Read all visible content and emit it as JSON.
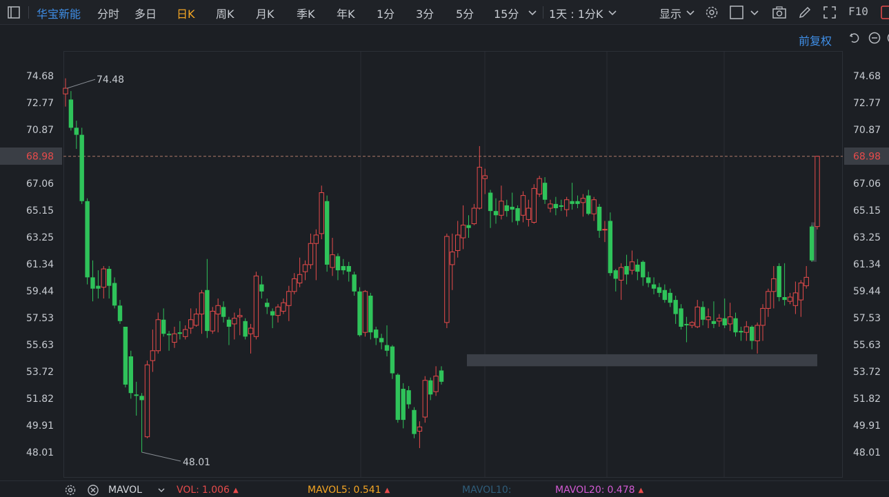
{
  "toolbar": {
    "stock_name": "华宝新能",
    "periods": [
      "分时",
      "多日",
      "日K",
      "周K",
      "月K",
      "季K",
      "年K",
      "1分",
      "3分",
      "5分",
      "15分"
    ],
    "active_period": "日K",
    "interval_select": "1天 : 1分K",
    "display_label": "显示",
    "f10_label": "F10"
  },
  "subbar": {
    "adjust_label": "前复权"
  },
  "colors": {
    "up": "#e84b4b",
    "down": "#2fc35a",
    "accent": "#3f8fe8",
    "active": "#f5a623",
    "background": "#1c1f24"
  },
  "chart_data": {
    "type": "candlestick",
    "y_axis_ticks": [
      "74.68",
      "72.77",
      "70.87",
      "68.98",
      "67.06",
      "65.15",
      "63.25",
      "61.34",
      "59.44",
      "57.53",
      "55.63",
      "53.72",
      "51.82",
      "49.91",
      "48.01"
    ],
    "ylim": [
      47.0,
      75.5
    ],
    "current_price": "68.98",
    "high_label": "74.48",
    "low_label": "48.01",
    "candles": [
      [
        73.4,
        73.8,
        72.5,
        74.5
      ],
      [
        73.0,
        71.0,
        70.8,
        73.6
      ],
      [
        71.0,
        70.5,
        69.5,
        71.5
      ],
      [
        70.5,
        65.8,
        65.6,
        71.0
      ],
      [
        65.8,
        60.4,
        59.9,
        66.0
      ],
      [
        60.4,
        59.6,
        58.7,
        61.6
      ],
      [
        59.8,
        59.6,
        58.9,
        60.9
      ],
      [
        59.7,
        61.0,
        58.9,
        61.2
      ],
      [
        61.0,
        59.8,
        58.9,
        61.2
      ],
      [
        60.0,
        58.4,
        58.2,
        60.4
      ],
      [
        58.4,
        57.3,
        57.1,
        58.8
      ],
      [
        56.9,
        52.8,
        52.6,
        56.9
      ],
      [
        54.8,
        52.2,
        51.8,
        55.2
      ],
      [
        52.1,
        52.0,
        50.6,
        53.0
      ],
      [
        52.0,
        51.7,
        48.0,
        52.2
      ],
      [
        49.1,
        54.2,
        49.0,
        54.5
      ],
      [
        54.5,
        55.2,
        53.7,
        56.7
      ],
      [
        55.2,
        57.4,
        55.0,
        57.9
      ],
      [
        57.4,
        56.4,
        56.2,
        58.2
      ],
      [
        56.4,
        56.3,
        55.2,
        56.6
      ],
      [
        55.8,
        56.4,
        55.4,
        56.9
      ],
      [
        56.5,
        56.4,
        56.0,
        57.3
      ],
      [
        56.2,
        56.7,
        56.0,
        57.0
      ],
      [
        56.8,
        57.4,
        56.4,
        58.2
      ],
      [
        57.0,
        57.8,
        56.9,
        58.2
      ],
      [
        57.8,
        59.3,
        56.4,
        59.5
      ],
      [
        59.5,
        56.6,
        56.1,
        61.7
      ],
      [
        56.6,
        58.0,
        56.4,
        58.3
      ],
      [
        57.8,
        58.4,
        56.5,
        58.9
      ],
      [
        58.3,
        57.6,
        57.2,
        58.7
      ],
      [
        57.4,
        56.9,
        55.6,
        57.6
      ],
      [
        57.1,
        57.5,
        56.0,
        57.9
      ],
      [
        57.6,
        57.7,
        56.3,
        58.2
      ],
      [
        57.3,
        56.2,
        56.0,
        57.5
      ],
      [
        56.4,
        56.8,
        55.0,
        57.1
      ],
      [
        56.2,
        60.5,
        56.0,
        60.8
      ],
      [
        59.9,
        59.4,
        58.9,
        60.5
      ],
      [
        58.6,
        58.3,
        57.8,
        58.9
      ],
      [
        58.0,
        57.7,
        56.8,
        58.2
      ],
      [
        57.7,
        58.3,
        57.2,
        58.5
      ],
      [
        58.0,
        58.6,
        57.8,
        58.9
      ],
      [
        58.4,
        59.4,
        57.3,
        59.8
      ],
      [
        59.4,
        60.3,
        59.2,
        60.7
      ],
      [
        60.0,
        60.6,
        59.7,
        61.8
      ],
      [
        60.8,
        61.3,
        60.2,
        61.6
      ],
      [
        61.3,
        62.8,
        61.0,
        63.5
      ],
      [
        62.8,
        63.4,
        60.2,
        63.8
      ],
      [
        63.5,
        66.4,
        63.1,
        66.9
      ],
      [
        65.8,
        61.3,
        60.8,
        66.2
      ],
      [
        61.1,
        62.0,
        60.5,
        63.2
      ],
      [
        61.9,
        60.9,
        60.2,
        62.1
      ],
      [
        61.2,
        60.9,
        60.6,
        61.7
      ],
      [
        61.2,
        60.8,
        60.1,
        61.5
      ],
      [
        60.6,
        59.4,
        59.1,
        60.8
      ],
      [
        59.4,
        56.3,
        56.2,
        59.7
      ],
      [
        56.5,
        59.4,
        56.2,
        59.5
      ],
      [
        59.1,
        56.5,
        56.0,
        59.3
      ],
      [
        56.7,
        56.1,
        55.6,
        56.9
      ],
      [
        56.1,
        55.8,
        55.3,
        56.4
      ],
      [
        55.6,
        55.2,
        54.8,
        57.0
      ],
      [
        55.5,
        53.6,
        53.2,
        55.6
      ],
      [
        53.5,
        50.3,
        50.1,
        53.6
      ],
      [
        52.5,
        50.3,
        49.7,
        52.9
      ],
      [
        52.4,
        51.4,
        51.1,
        52.7
      ],
      [
        51.0,
        49.3,
        49.0,
        51.2
      ],
      [
        49.5,
        49.8,
        48.3,
        50.2
      ],
      [
        50.5,
        53.1,
        50.1,
        53.4
      ],
      [
        53.1,
        52.1,
        51.7,
        53.3
      ],
      [
        52.3,
        53.4,
        52.0,
        54.1
      ],
      [
        53.8,
        53.0,
        52.8,
        54.1
      ],
      [
        57.2,
        63.3,
        56.8,
        63.5
      ],
      [
        61.3,
        62.2,
        59.5,
        63.5
      ],
      [
        62.3,
        63.4,
        61.8,
        64.4
      ],
      [
        63.2,
        64.1,
        62.4,
        65.5
      ],
      [
        64.1,
        63.9,
        63.2,
        64.8
      ],
      [
        64.2,
        65.3,
        64.1,
        65.6
      ],
      [
        65.3,
        68.2,
        65.2,
        69.7
      ],
      [
        67.4,
        67.6,
        66.3,
        68.1
      ],
      [
        66.4,
        65.1,
        63.9,
        66.6
      ],
      [
        65.1,
        64.8,
        64.2,
        66.0
      ],
      [
        64.8,
        65.8,
        64.5,
        66.9
      ],
      [
        65.5,
        65.1,
        64.7,
        65.9
      ],
      [
        65.4,
        65.2,
        64.3,
        66.4
      ],
      [
        65.3,
        64.4,
        64.1,
        65.5
      ],
      [
        64.8,
        66.2,
        64.3,
        66.5
      ],
      [
        64.5,
        65.3,
        64.0,
        65.9
      ],
      [
        64.3,
        66.7,
        64.2,
        67.0
      ],
      [
        66.3,
        67.4,
        66.1,
        67.6
      ],
      [
        67.1,
        65.9,
        65.6,
        67.5
      ],
      [
        65.3,
        65.6,
        65.0,
        65.9
      ],
      [
        65.6,
        65.3,
        64.8,
        66.1
      ],
      [
        65.5,
        65.4,
        65.1,
        65.9
      ],
      [
        65.2,
        65.9,
        64.7,
        66.1
      ],
      [
        65.8,
        65.6,
        65.2,
        67.1
      ],
      [
        65.8,
        65.6,
        65.3,
        66.2
      ],
      [
        65.7,
        66.0,
        64.7,
        66.3
      ],
      [
        66.2,
        64.9,
        64.8,
        66.6
      ],
      [
        64.9,
        65.9,
        64.4,
        66.1
      ],
      [
        65.4,
        63.7,
        63.2,
        65.6
      ],
      [
        63.8,
        63.8,
        62.9,
        64.4
      ],
      [
        64.4,
        60.7,
        60.5,
        65.0
      ],
      [
        60.9,
        60.3,
        59.4,
        61.0
      ],
      [
        60.2,
        61.1,
        58.8,
        61.4
      ],
      [
        61.2,
        60.6,
        59.9,
        62.0
      ],
      [
        60.9,
        61.5,
        60.6,
        62.3
      ],
      [
        61.3,
        60.8,
        60.2,
        61.7
      ],
      [
        61.5,
        60.4,
        59.8,
        61.6
      ],
      [
        60.4,
        60.0,
        59.7,
        60.8
      ],
      [
        59.9,
        59.6,
        59.2,
        60.4
      ],
      [
        59.7,
        59.3,
        59.0,
        60.0
      ],
      [
        59.5,
        58.8,
        58.6,
        59.9
      ],
      [
        59.3,
        58.6,
        58.3,
        59.6
      ],
      [
        58.8,
        57.8,
        57.1,
        59.1
      ],
      [
        58.2,
        56.9,
        56.7,
        58.5
      ],
      [
        57.1,
        57.0,
        55.8,
        57.6
      ],
      [
        57.0,
        57.2,
        56.8,
        57.3
      ],
      [
        56.9,
        58.3,
        56.8,
        58.8
      ],
      [
        58.3,
        57.4,
        57.0,
        58.7
      ],
      [
        57.4,
        57.6,
        56.8,
        58.2
      ],
      [
        57.3,
        57.1,
        56.8,
        58.7
      ],
      [
        57.3,
        57.5,
        56.9,
        57.8
      ],
      [
        57.5,
        57.0,
        56.8,
        58.9
      ],
      [
        57.1,
        57.6,
        56.6,
        58.6
      ],
      [
        57.5,
        56.5,
        56.2,
        57.9
      ],
      [
        56.6,
        56.5,
        55.9,
        56.9
      ],
      [
        56.5,
        56.9,
        55.9,
        57.3
      ],
      [
        56.9,
        55.9,
        55.3,
        57.0
      ],
      [
        55.9,
        57.0,
        55.0,
        57.2
      ],
      [
        57.0,
        58.2,
        55.9,
        58.5
      ],
      [
        58.2,
        59.4,
        57.6,
        59.6
      ],
      [
        59.4,
        60.3,
        58.2,
        61.2
      ],
      [
        61.2,
        59.0,
        58.7,
        61.4
      ],
      [
        59.0,
        58.8,
        58.4,
        61.4
      ],
      [
        58.7,
        59.0,
        58.5,
        59.3
      ],
      [
        58.4,
        59.3,
        57.8,
        60.1
      ],
      [
        58.8,
        60.0,
        57.6,
        60.2
      ],
      [
        59.8,
        60.4,
        59.6,
        61.2
      ],
      [
        64.0,
        61.6,
        61.5,
        64.1
      ],
      [
        64.0,
        68.98,
        63.8,
        69.0
      ]
    ],
    "volume_indicator": {
      "name": "MAVOL",
      "vol_label": "VOL:",
      "vol_value": "1.006",
      "mavol5_label": "MAVOL5:",
      "mavol5_value": "0.541",
      "mavol10_label": "MAVOL10:",
      "mavol20_label": "MAVOL20:",
      "mavol20_value": "0.478"
    }
  }
}
